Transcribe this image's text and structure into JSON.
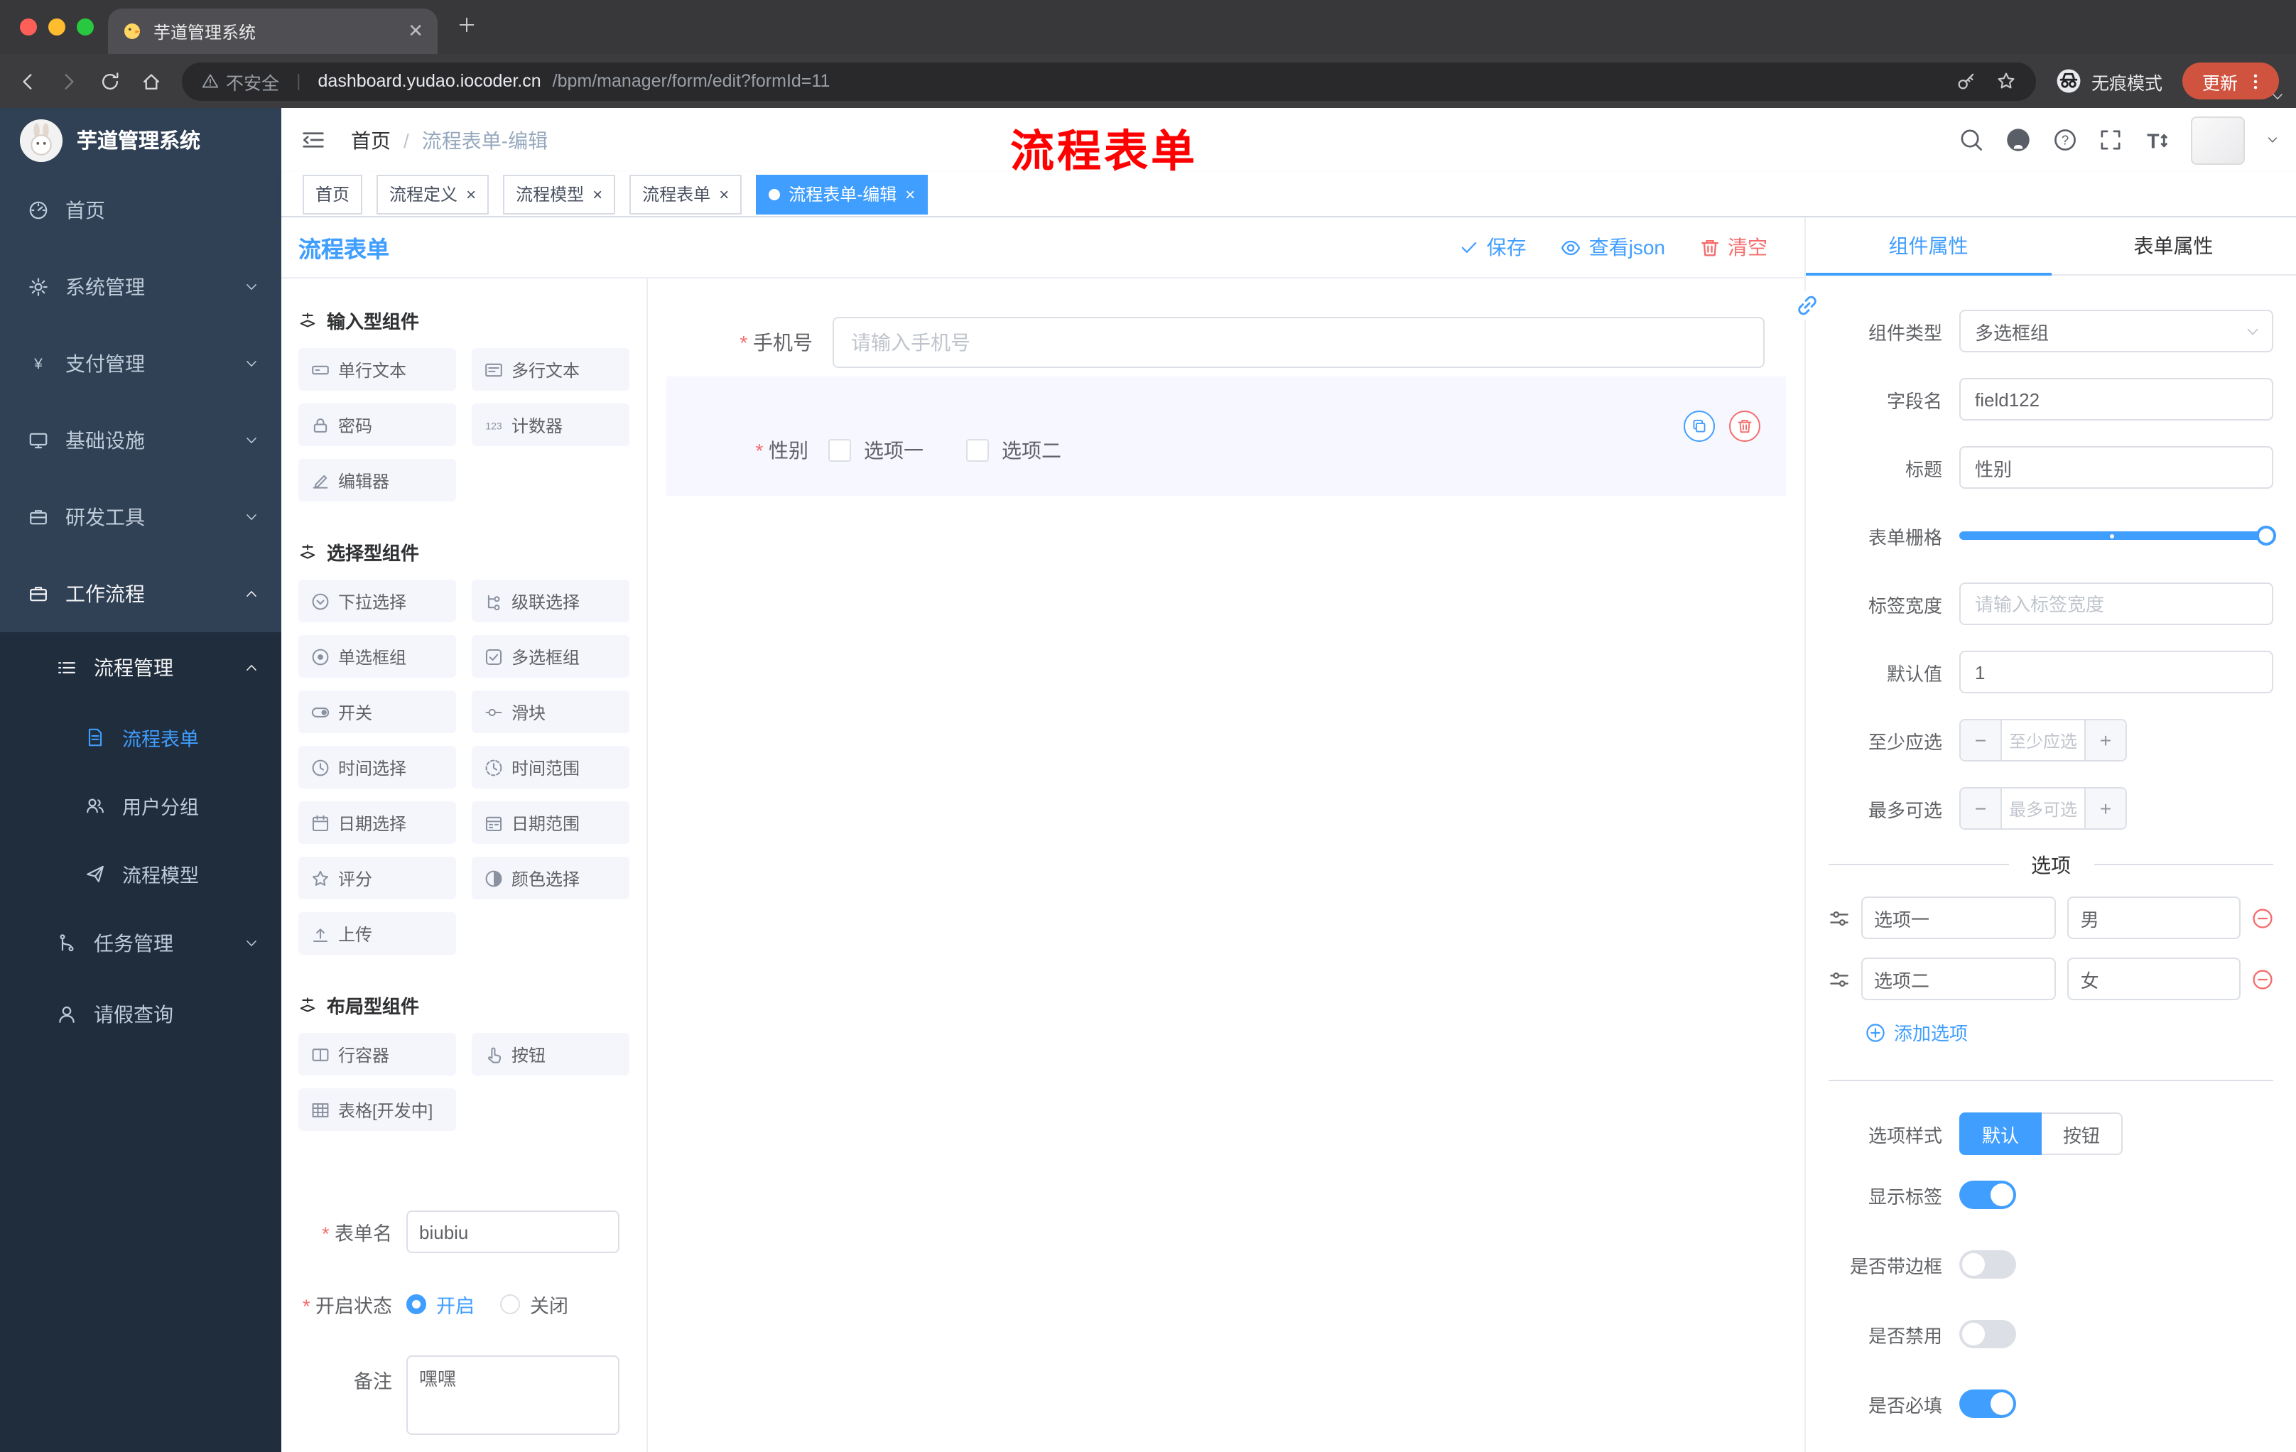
{
  "browser": {
    "tab_title": "芋道管理系统",
    "url_security": "不安全",
    "url_host": "dashboard.yudao.iocoder.cn",
    "url_path": "/bpm/manager/form/edit?formId=11",
    "incognito_label": "无痕模式",
    "update_label": "更新"
  },
  "sidebar": {
    "logo_title": "芋道管理系统",
    "menu": [
      {
        "key": "home",
        "label": "首页",
        "icon": "dashboard",
        "level": 1
      },
      {
        "key": "system-mgmt",
        "label": "系统管理",
        "icon": "gear",
        "level": 1,
        "chevron": "down"
      },
      {
        "key": "payment-mgmt",
        "label": "支付管理",
        "icon": "yen",
        "level": 1,
        "chevron": "down"
      },
      {
        "key": "infrastructure",
        "label": "基础设施",
        "icon": "monitor",
        "level": 1,
        "chevron": "down"
      },
      {
        "key": "dev-tools",
        "label": "研发工具",
        "icon": "briefcase",
        "level": 1,
        "chevron": "down"
      },
      {
        "key": "workflow",
        "label": "工作流程",
        "icon": "briefcase",
        "level": 1,
        "chevron": "up",
        "open": true
      },
      {
        "key": "process-mgmt",
        "label": "流程管理",
        "icon": "list",
        "level": 2,
        "chevron": "up",
        "open": true
      },
      {
        "key": "process-form",
        "label": "流程表单",
        "icon": "document",
        "level": 3,
        "active": true
      },
      {
        "key": "user-group",
        "label": "用户分组",
        "icon": "users",
        "level": 3
      },
      {
        "key": "process-model",
        "label": "流程模型",
        "icon": "send",
        "level": 3
      },
      {
        "key": "task-mgmt",
        "label": "任务管理",
        "icon": "branch",
        "level": 2,
        "chevron": "down"
      },
      {
        "key": "leave-query",
        "label": "请假查询",
        "icon": "user",
        "level": 2
      }
    ]
  },
  "header": {
    "breadcrumb": {
      "root": "首页",
      "current": "流程表单-编辑"
    },
    "annotation": "流程表单"
  },
  "tags": [
    {
      "key": "home",
      "label": "首页",
      "closable": false,
      "active": false
    },
    {
      "key": "process-definition",
      "label": "流程定义",
      "closable": true,
      "active": false
    },
    {
      "key": "process-model",
      "label": "流程模型",
      "closable": true,
      "active": false
    },
    {
      "key": "process-form",
      "label": "流程表单",
      "closable": true,
      "active": false
    },
    {
      "key": "process-form-edit",
      "label": "流程表单-编辑",
      "closable": true,
      "active": true
    }
  ],
  "designer": {
    "panel_title": "流程表单",
    "toolbar": {
      "save": "保存",
      "view_json": "查看json",
      "clear": "清空"
    },
    "palette": [
      {
        "title": "输入型组件",
        "items": [
          {
            "key": "single-line-text",
            "icon": "single-line",
            "label": "单行文本"
          },
          {
            "key": "multi-line-text",
            "icon": "multi-line",
            "label": "多行文本"
          },
          {
            "key": "password",
            "icon": "password",
            "label": "密码"
          },
          {
            "key": "counter",
            "icon": "counter",
            "label": "计数器"
          },
          {
            "key": "editor",
            "icon": "editor",
            "label": "编辑器"
          }
        ]
      },
      {
        "title": "选择型组件",
        "items": [
          {
            "key": "select",
            "icon": "select",
            "label": "下拉选择"
          },
          {
            "key": "cascader",
            "icon": "cascader",
            "label": "级联选择"
          },
          {
            "key": "radio-group",
            "icon": "radio",
            "label": "单选框组"
          },
          {
            "key": "checkbox-group",
            "icon": "checkbox",
            "label": "多选框组"
          },
          {
            "key": "switch",
            "icon": "switch",
            "label": "开关"
          },
          {
            "key": "slider",
            "icon": "slider-ic",
            "label": "滑块"
          },
          {
            "key": "time-picker",
            "icon": "time",
            "label": "时间选择"
          },
          {
            "key": "time-range",
            "icon": "time-range",
            "label": "时间范围"
          },
          {
            "key": "date-picker",
            "icon": "date",
            "label": "日期选择"
          },
          {
            "key": "date-range",
            "icon": "date-range",
            "label": "日期范围"
          },
          {
            "key": "rate",
            "icon": "rate",
            "label": "评分"
          },
          {
            "key": "color-picker",
            "icon": "color",
            "label": "颜色选择"
          },
          {
            "key": "upload",
            "icon": "upload",
            "label": "上传"
          }
        ]
      },
      {
        "title": "布局型组件",
        "items": [
          {
            "key": "row-container",
            "icon": "row",
            "label": "行容器"
          },
          {
            "key": "button",
            "icon": "button",
            "label": "按钮"
          },
          {
            "key": "table-dev",
            "icon": "table",
            "label": "表格[开发中]"
          }
        ]
      }
    ],
    "meta": {
      "form_name_label": "表单名",
      "form_name_value": "biubiu",
      "status_label": "开启状态",
      "status_options": [
        {
          "label": "开启",
          "selected": true
        },
        {
          "label": "关闭",
          "selected": false
        }
      ],
      "remark_label": "备注",
      "remark_value": "嘿嘿"
    },
    "canvas": {
      "phone": {
        "label": "手机号",
        "placeholder": "请输入手机号"
      },
      "gender": {
        "label": "性别",
        "options": [
          "选项一",
          "选项二"
        ]
      }
    }
  },
  "props": {
    "tabs": [
      {
        "label": "组件属性",
        "active": true
      },
      {
        "label": "表单属性",
        "active": false
      }
    ],
    "fields": {
      "component_type": {
        "label": "组件类型",
        "value": "多选框组"
      },
      "field_name": {
        "label": "字段名",
        "value": "field122"
      },
      "title": {
        "label": "标题",
        "value": "性别"
      },
      "grid": {
        "label": "表单栅格"
      },
      "label_width": {
        "label": "标签宽度",
        "placeholder": "请输入标签宽度"
      },
      "default_value": {
        "label": "默认值",
        "value": "1"
      },
      "min_select": {
        "label": "至少应选",
        "placeholder": "至少应选"
      },
      "max_select": {
        "label": "最多可选",
        "placeholder": "最多可选"
      }
    },
    "options": {
      "divider_label": "选项",
      "items": [
        {
          "label": "选项一",
          "value": "男"
        },
        {
          "label": "选项二",
          "value": "女"
        }
      ],
      "add_label": "添加选项"
    },
    "style": {
      "label": "选项样式",
      "choices": [
        {
          "label": "默认",
          "active": true
        },
        {
          "label": "按钮",
          "active": false
        }
      ]
    },
    "switches": [
      {
        "key": "show-label",
        "label": "显示标签",
        "on": true
      },
      {
        "key": "bordered",
        "label": "是否带边框",
        "on": false
      },
      {
        "key": "disabled",
        "label": "是否禁用",
        "on": false
      },
      {
        "key": "required",
        "label": "是否必填",
        "on": true
      }
    ],
    "accent_color": "#409eff",
    "danger_color": "#f56c6c"
  }
}
